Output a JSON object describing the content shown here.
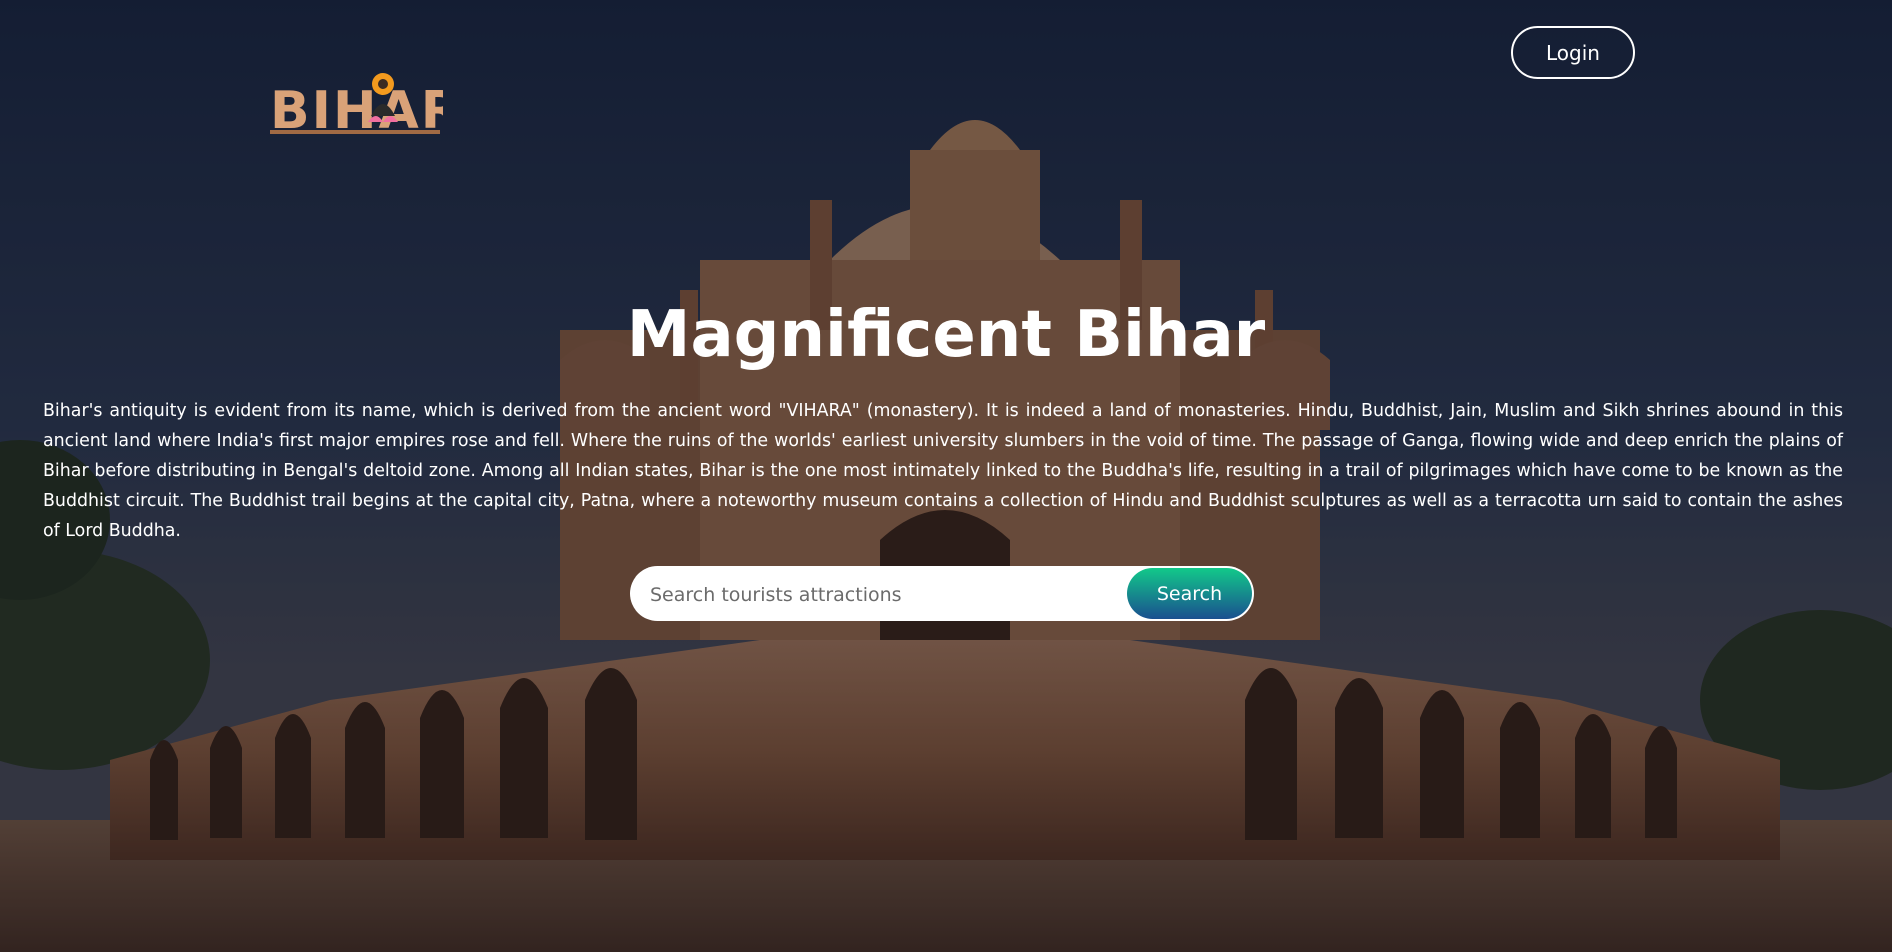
{
  "header": {
    "logo_text": "BIHAR",
    "login_label": "Login"
  },
  "hero": {
    "title": "Magnificent Bihar",
    "description": "Bihar's antiquity is evident from its name, which is derived from the ancient word \"VIHARA\" (monastery). It is indeed a land of monasteries. Hindu, Buddhist, Jain, Muslim and Sikh shrines abound in this ancient land where India's first major empires rose and fell. Where the ruins of the worlds' earliest university slumbers in the void of time. The passage of Ganga, flowing wide and deep enrich the plains of Bihar before distributing in Bengal's deltoid zone. Among all Indian states, Bihar is the one most intimately linked to the Buddha's life, resulting in a trail of pilgrimages which have come to be known as the Buddhist circuit. The Buddhist trail begins at the capital city, Patna, where a noteworthy museum contains a collection of Hindu and Buddhist sculptures as well as a terracotta urn said to contain the ashes of Lord Buddha."
  },
  "search": {
    "placeholder": "Search tourists attractions",
    "value": "",
    "button_label": "Search"
  },
  "colors": {
    "logo": "#d9a278",
    "logo_accent": "#f39a1e",
    "button_gradient_top": "#12c98a",
    "button_gradient_bottom": "#1a4f8f",
    "text": "#ffffff"
  },
  "icons": {
    "logo_emblem": "buddha-lotus-icon"
  }
}
